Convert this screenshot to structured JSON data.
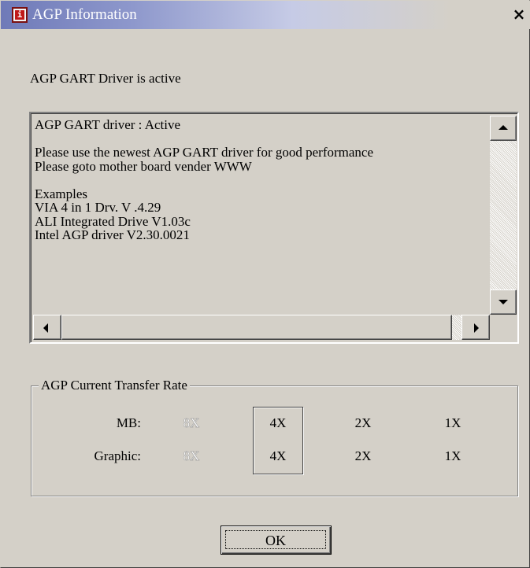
{
  "window": {
    "title": "AGP Information",
    "icon_name": "info-app-icon",
    "close_label": "×"
  },
  "status_text": "AGP GART Driver is active",
  "info_text": {
    "lines": [
      "AGP GART driver : Active",
      "",
      "Please use the newest AGP GART driver for good performance",
      "Please goto mother board vender WWW",
      "",
      "Examples",
      "VIA 4 in 1 Drv. V .4.29",
      "ALI Integrated Drive V1.03c",
      "Intel AGP driver V2.30.0021"
    ]
  },
  "transfer_rate": {
    "group_label": "AGP Current Transfer Rate",
    "rows": [
      {
        "label": "MB:",
        "rates": [
          "8X",
          "4X",
          "2X",
          "1X"
        ],
        "disabled": [
          true,
          false,
          false,
          false
        ]
      },
      {
        "label": "Graphic:",
        "rates": [
          "8X",
          "4X",
          "2X",
          "1X"
        ],
        "disabled": [
          true,
          false,
          false,
          false
        ]
      }
    ],
    "selected_rate": "4X"
  },
  "buttons": {
    "ok_label": "OK"
  },
  "colors": {
    "dialog_bg": "#d4d0c8",
    "title_gradient_start": "#6f7ab8",
    "disabled_text": "#9a9a9a"
  }
}
